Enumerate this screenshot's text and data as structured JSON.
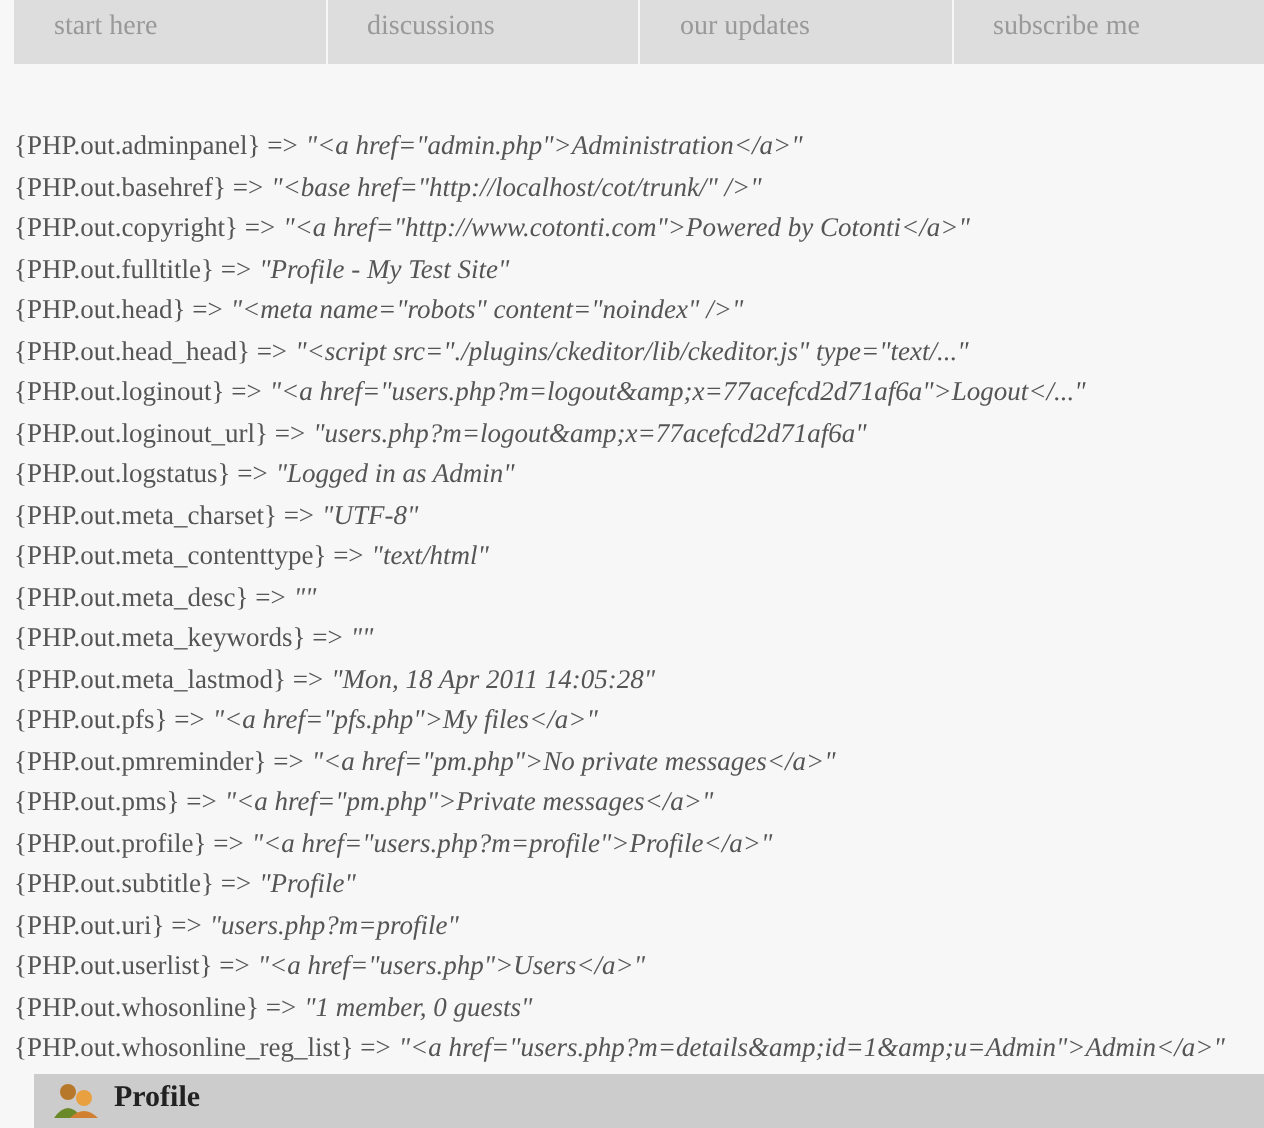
{
  "nav_tabs": [
    {
      "subtitle": "start here"
    },
    {
      "subtitle": "discussions"
    },
    {
      "subtitle": "our updates"
    },
    {
      "subtitle": "subscribe me"
    }
  ],
  "variables": [
    {
      "key": "{PHP.out.adminpanel} =>",
      "value": "\"<a href=\"admin.php\">Administration</a>\""
    },
    {
      "key": "{PHP.out.basehref} =>",
      "value": "\"<base href=\"http://localhost/cot/trunk/\" />\""
    },
    {
      "key": "{PHP.out.copyright} =>",
      "value": "\"<a href=\"http://www.cotonti.com\">Powered by Cotonti</a>\""
    },
    {
      "key": "{PHP.out.fulltitle} =>",
      "value": "\"Profile - My Test Site\""
    },
    {
      "key": "{PHP.out.head} =>",
      "value": "\"<meta name=\"robots\" content=\"noindex\" />\""
    },
    {
      "key": "{PHP.out.head_head} =>",
      "value": "\"<script src=\"./plugins/ckeditor/lib/ckeditor.js\" type=\"text/...\""
    },
    {
      "key": "{PHP.out.loginout} =>",
      "value": "\"<a href=\"users.php?m=logout&amp;x=77acefcd2d71af6a\">Logout</...\""
    },
    {
      "key": "{PHP.out.loginout_url} =>",
      "value": "\"users.php?m=logout&amp;x=77acefcd2d71af6a\""
    },
    {
      "key": "{PHP.out.logstatus} =>",
      "value": "\"Logged in as Admin\""
    },
    {
      "key": "{PHP.out.meta_charset} =>",
      "value": "\"UTF-8\""
    },
    {
      "key": "{PHP.out.meta_contenttype} =>",
      "value": "\"text/html\""
    },
    {
      "key": "{PHP.out.meta_desc} =>",
      "value": "\"\""
    },
    {
      "key": "{PHP.out.meta_keywords} =>",
      "value": "\"\""
    },
    {
      "key": "{PHP.out.meta_lastmod} =>",
      "value": "\"Mon, 18 Apr 2011 14:05:28\""
    },
    {
      "key": "{PHP.out.pfs} =>",
      "value": "\"<a href=\"pfs.php\">My files</a>\""
    },
    {
      "key": "{PHP.out.pmreminder} =>",
      "value": "\"<a href=\"pm.php\">No private messages</a>\""
    },
    {
      "key": "{PHP.out.pms} =>",
      "value": "\"<a href=\"pm.php\">Private messages</a>\""
    },
    {
      "key": "{PHP.out.profile} =>",
      "value": "\"<a href=\"users.php?m=profile\">Profile</a>\""
    },
    {
      "key": "{PHP.out.subtitle} =>",
      "value": "\"Profile\""
    },
    {
      "key": "{PHP.out.uri} =>",
      "value": "\"users.php?m=profile\""
    },
    {
      "key": "{PHP.out.userlist} =>",
      "value": "\"<a href=\"users.php\">Users</a>\""
    },
    {
      "key": "{PHP.out.whosonline} =>",
      "value": "\"1 member, 0 guests\""
    },
    {
      "key": "{PHP.out.whosonline_reg_list} =>",
      "value": "\"<a href=\"users.php?m=details&amp;id=1&amp;u=Admin\">Admin</a>\""
    }
  ],
  "section": {
    "title": "Profile"
  }
}
